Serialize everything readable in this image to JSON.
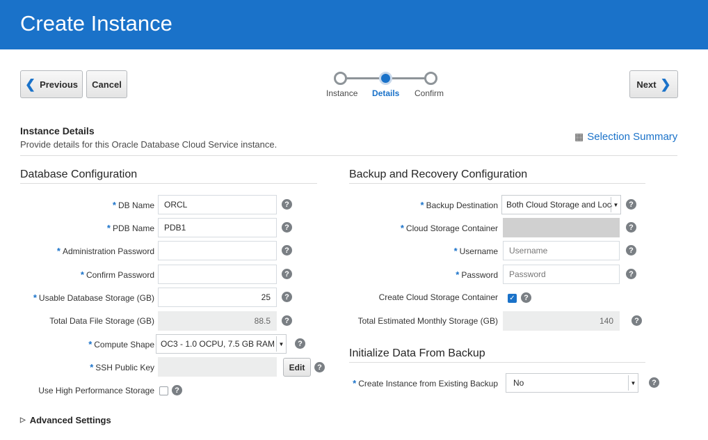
{
  "header": {
    "title": "Create Instance"
  },
  "nav": {
    "previous_label": "Previous",
    "cancel_label": "Cancel",
    "next_label": "Next"
  },
  "train": {
    "steps": [
      "Instance",
      "Details",
      "Confirm"
    ],
    "active_step": "Details"
  },
  "instance_details": {
    "title": "Instance Details",
    "description": "Provide details for this Oracle Database Cloud Service instance.",
    "summary_link": "Selection Summary"
  },
  "database_config": {
    "title": "Database Configuration",
    "fields": {
      "db_name": {
        "label": "DB Name",
        "value": "ORCL"
      },
      "pdb_name": {
        "label": "PDB Name",
        "value": "PDB1"
      },
      "admin_password": {
        "label": "Administration Password",
        "value": ""
      },
      "confirm_password": {
        "label": "Confirm Password",
        "value": ""
      },
      "usable_storage": {
        "label": "Usable Database Storage (GB)",
        "value": "25"
      },
      "total_data_storage": {
        "label": "Total Data File Storage (GB)",
        "value": "88.5"
      },
      "compute_shape": {
        "label": "Compute Shape",
        "value": "OC3 - 1.0 OCPU, 7.5 GB RAM"
      },
      "ssh_key": {
        "label": "SSH Public Key",
        "value": "",
        "edit_label": "Edit"
      },
      "high_perf_storage": {
        "label": "Use High Performance Storage",
        "checked": false
      }
    }
  },
  "backup_config": {
    "title": "Backup and Recovery Configuration",
    "fields": {
      "backup_destination": {
        "label": "Backup Destination",
        "value": "Both Cloud Storage and Loca"
      },
      "cloud_container": {
        "label": "Cloud Storage Container",
        "value": ""
      },
      "username": {
        "label": "Username",
        "placeholder": "Username"
      },
      "password": {
        "label": "Password",
        "placeholder": "Password"
      },
      "create_container": {
        "label": "Create Cloud Storage Container",
        "checked": true
      },
      "monthly_storage": {
        "label": "Total Estimated Monthly Storage (GB)",
        "value": "140"
      }
    }
  },
  "initialize": {
    "title": "Initialize Data From Backup",
    "fields": {
      "from_backup": {
        "label": "Create Instance from Existing Backup",
        "value": "No"
      }
    }
  },
  "advanced": {
    "label": "Advanced Settings"
  },
  "icons": {
    "help": "?",
    "chevron_left": "❮",
    "chevron_right": "❯",
    "summary": "▦",
    "triangle": "▷",
    "check": "✓",
    "dropdown": "▼"
  },
  "colors": {
    "brand": "#1a72c9",
    "header_bg": "#1a72c9"
  }
}
